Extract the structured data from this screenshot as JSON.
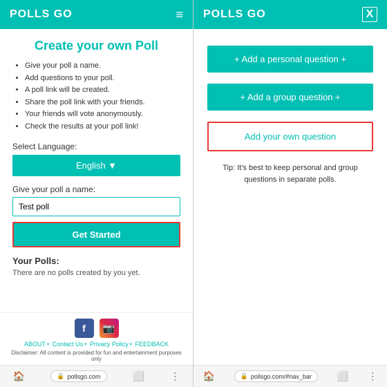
{
  "left": {
    "header": {
      "logo": "POLLS GO",
      "hamburger": "≡"
    },
    "main": {
      "title": "Create your own Poll",
      "bullets": [
        "Give your poll a name.",
        "Add questions to your poll.",
        "A poll link will be created.",
        "Share the poll link with your friends.",
        "Your friends will vote anonymously.",
        "Check the results at your poll link!"
      ],
      "select_language_label": "Select Language:",
      "language_btn": "English ▼",
      "poll_name_label": "Give your poll a name:",
      "poll_name_value": "Test poll",
      "get_started_btn": "Get Started",
      "your_polls_label": "Your Polls:",
      "no_polls_text": "There are no polls created by you yet."
    },
    "footer": {
      "facebook_label": "f",
      "instagram_label": "📷",
      "links": [
        "ABOUT",
        "Contact Us",
        "Privacy Policy",
        "FEEDBACK"
      ],
      "disclaimer": "Disclaimer: All content is provided for fun and entertainment purposes only"
    },
    "bottom_bar": {
      "url": "pollsgo.com"
    }
  },
  "right": {
    "header": {
      "logo": "POLLS GO",
      "close": "X"
    },
    "main": {
      "personal_btn": "+ Add a personal question +",
      "group_btn": "+ Add a group question +",
      "own_btn": "Add your own question",
      "tip": "Tip: It's best to keep personal and group questions in separate polls."
    },
    "bottom_bar": {
      "url": "pollsgo.com/#nav_bar"
    }
  }
}
